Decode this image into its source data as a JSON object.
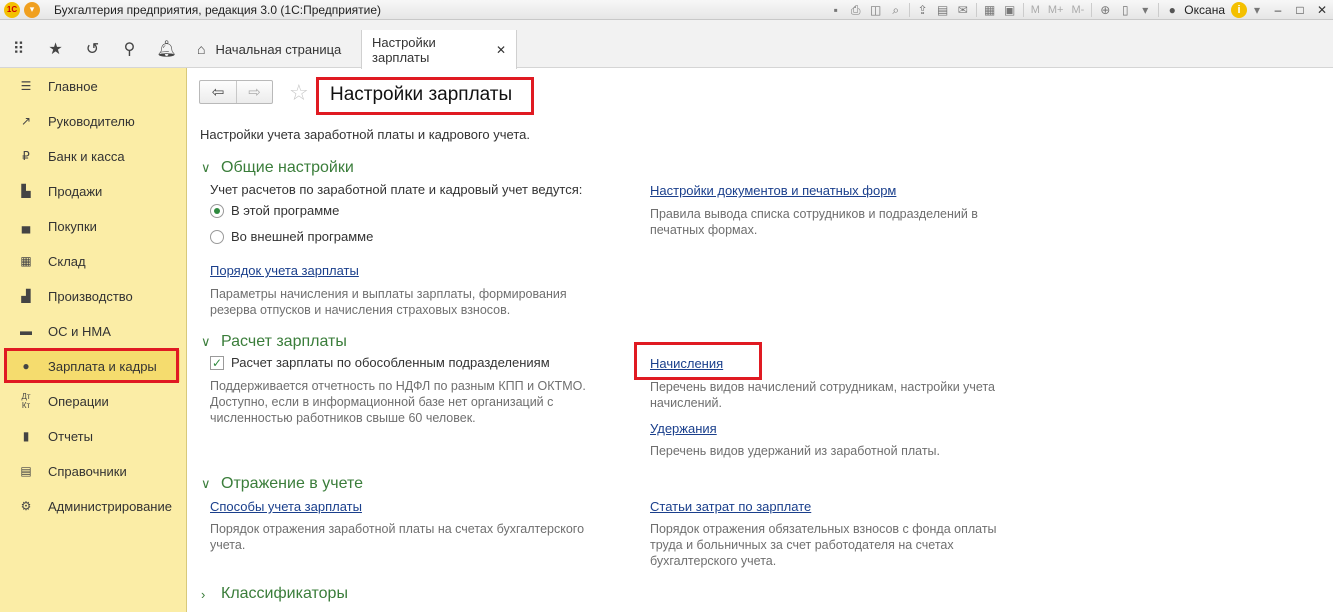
{
  "window": {
    "title": "Бухгалтерия предприятия, редакция 3.0  (1С:Предприятие)",
    "logo": "1С",
    "user": "Оксана",
    "toolbar_m": [
      "M",
      "M+",
      "M-"
    ]
  },
  "tabs": {
    "home_label": "Начальная страница",
    "active_label": "Настройки зарплаты"
  },
  "sidebar": {
    "items": [
      {
        "label": "Главное",
        "icon": "menu-icon"
      },
      {
        "label": "Руководителю",
        "icon": "trend-icon"
      },
      {
        "label": "Банк и касса",
        "icon": "ruble-icon"
      },
      {
        "label": "Продажи",
        "icon": "cart-icon"
      },
      {
        "label": "Покупки",
        "icon": "truck-icon"
      },
      {
        "label": "Склад",
        "icon": "warehouse-icon"
      },
      {
        "label": "Производство",
        "icon": "factory-icon"
      },
      {
        "label": "ОС и НМА",
        "icon": "car-icon"
      },
      {
        "label": "Зарплата и кадры",
        "icon": "person-icon"
      },
      {
        "label": "Операции",
        "icon": "dt-kt-icon"
      },
      {
        "label": "Отчеты",
        "icon": "bar-chart-icon"
      },
      {
        "label": "Справочники",
        "icon": "book-icon"
      },
      {
        "label": "Администрирование",
        "icon": "gear-icon"
      }
    ],
    "active_index": 8
  },
  "page": {
    "title": "Настройки зарплаты",
    "subtitle": "Настройки учета заработной платы и кадрового учета.",
    "general": {
      "heading": "Общие настройки",
      "question": "Учет расчетов по заработной плате и кадровый учет ведутся:",
      "radio_this": "В этой программе",
      "radio_external": "Во внешней программе",
      "link_order": "Порядок учета зарплаты",
      "desc_order": "Параметры начисления и выплаты зарплаты, формирования резерва отпусков и начисления страховых взносов.",
      "link_docs": "Настройки документов и печатных форм",
      "desc_docs": "Правила вывода списка сотрудников и подразделений в печатных формах."
    },
    "calc": {
      "heading": "Расчет зарплаты",
      "checkbox_label": "Расчет зарплаты по обособленным подразделениям",
      "checkbox_checked": true,
      "checkbox_desc": "Поддерживается отчетность по НДФЛ по разным КПП и ОКТМО. Доступно, если в информационной базе нет организаций с численностью работников свыше 60 человек.",
      "link_accruals": "Начисления",
      "desc_accruals": "Перечень видов начислений сотрудникам, настройки учета начислений.",
      "link_deductions": "Удержания",
      "desc_deductions": "Перечень видов удержаний из заработной платы."
    },
    "accounting": {
      "heading": "Отражение в учете",
      "link_methods": "Способы учета зарплаты",
      "desc_methods": "Порядок отражения заработной платы на счетах бухгалтерского учета.",
      "link_costs": "Статьи затрат по зарплате",
      "desc_costs": "Порядок отражения обязательных взносов с фонда оплаты труда и больничных за счет работодателя на счетах бухгалтерского учета."
    },
    "classifiers": {
      "heading": "Классификаторы"
    }
  },
  "colors": {
    "sidebar_bg": "#fbeda6",
    "section_green": "#3a7d3a",
    "link_blue": "#1a3f8c",
    "highlight_red": "#e01a22"
  }
}
